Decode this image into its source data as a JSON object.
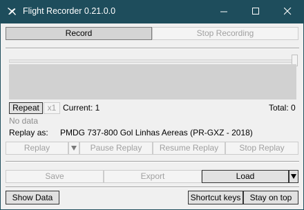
{
  "window": {
    "title": "Flight Recorder 0.21.0.0",
    "icon": "airplane-icon"
  },
  "record_tab": {
    "record_label": "Record",
    "stop_recording_label": "Stop Recording"
  },
  "controls": {
    "repeat_label": "Repeat",
    "speed_label": "x1",
    "current_text": "Current: 1",
    "total_text": "Total: 0",
    "status_text": "No data",
    "replay_as_label": "Replay as:",
    "replay_as_value": "PMDG 737-800 Gol Linhas Aereas (PR-GXZ - 2018)"
  },
  "replay_buttons": {
    "replay": "Replay",
    "pause": "Pause Replay",
    "resume": "Resume Replay",
    "stop": "Stop Replay"
  },
  "file_buttons": {
    "save": "Save",
    "export": "Export",
    "load": "Load"
  },
  "footer": {
    "show_data": "Show Data",
    "shortcut_keys": "Shortcut keys",
    "stay_on_top": "Stay on top"
  }
}
